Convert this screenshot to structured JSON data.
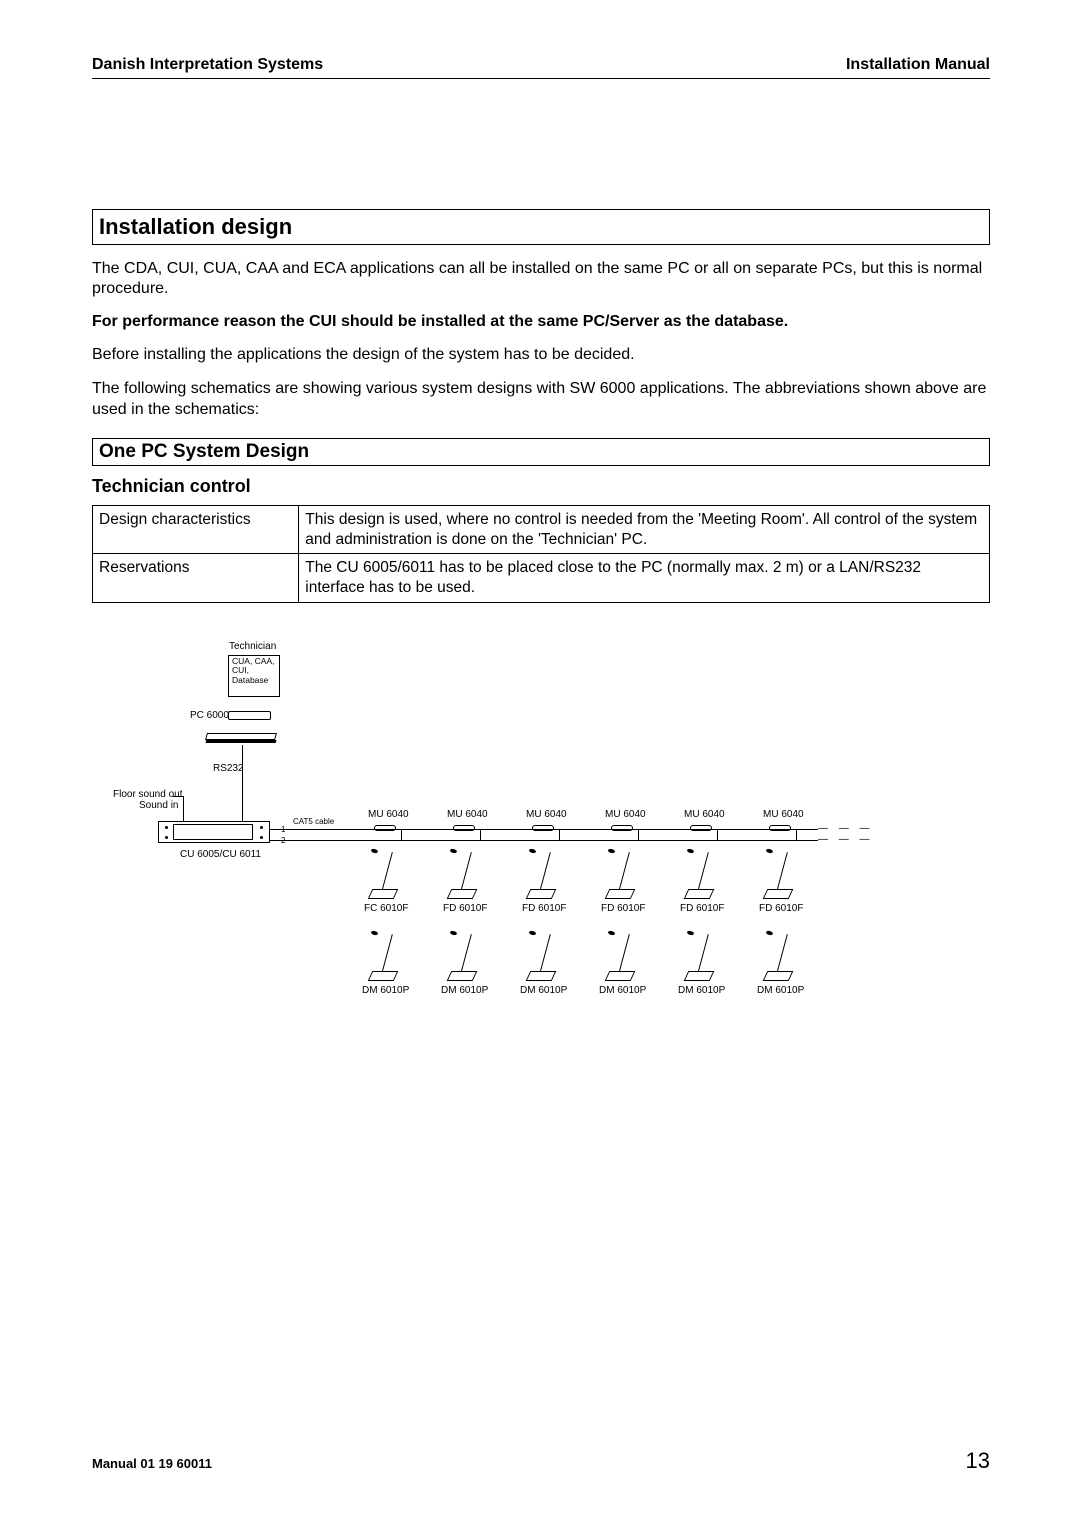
{
  "header": {
    "left": "Danish Interpretation Systems",
    "right": "Installation Manual"
  },
  "section_title": "Installation design",
  "para1": "The CDA, CUI, CUA, CAA and ECA applications can all be installed on the same PC or all on separate PCs, but this is normal procedure.",
  "bold_line": "For performance reason the CUI should be installed at the same PC/Server as the database.",
  "para2": "Before installing the applications the design of the system has to be decided.",
  "para3": "The following schematics are showing various system designs with SW 6000 applications. The abbreviations shown above are used in the schematics:",
  "subsection_title": "One PC System Design",
  "sub_heading": "Technician control",
  "table": {
    "r1c1": "Design characteristics",
    "r1c2": "This design is used, where no control is needed from the 'Meeting Room'. All control of the system and administration is done on the 'Technician' PC.",
    "r2c1": "Reservations",
    "r2c2": "The CU 6005/6011 has to be placed close to the PC (normally max. 2 m) or a LAN/RS232 interface has to be used."
  },
  "diagram": {
    "technician": "Technician",
    "box_apps": "CUA, CAA,\nCUI,\nDatabase",
    "pc6000": "PC 6000",
    "rs232": "RS232",
    "floor_sound_out": "Floor sound out",
    "sound_in": "Sound in",
    "cat5": "CAT5 cable",
    "line1": "1",
    "line2": "2",
    "cu_label": "CU 6005/CU 6011",
    "mu": "MU 6040",
    "fc": "FC 6010F",
    "fd": "FD 6010F",
    "dm": "DM 6010P"
  },
  "footer": {
    "manual": "Manual 01 19 60011",
    "page": "13"
  }
}
